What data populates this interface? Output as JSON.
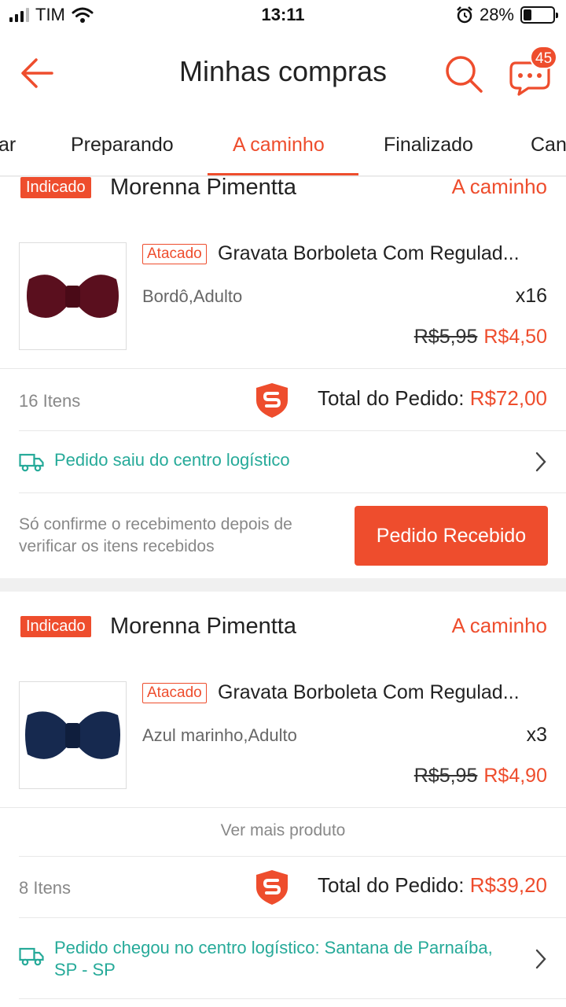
{
  "status_bar": {
    "carrier": "TIM",
    "time": "13:11",
    "battery": "28%",
    "battery_level": 0.28,
    "icons": [
      "signal-icon",
      "wifi-icon",
      "alarm-icon",
      "battery-icon"
    ]
  },
  "header": {
    "title": "Minhas compras",
    "chat_badge": "45",
    "icons": [
      "back-arrow-icon",
      "search-icon",
      "chat-icon"
    ]
  },
  "tabs": [
    {
      "label": "ar"
    },
    {
      "label": "Preparando"
    },
    {
      "label": "A caminho"
    },
    {
      "label": "Finalizado"
    },
    {
      "label": "Can"
    }
  ],
  "active_tab": "A caminho",
  "orders": [
    {
      "badge": "Indicado",
      "seller": "Morenna Pimentta",
      "status": "A caminho",
      "product": {
        "tag": "Atacado",
        "name": "Gravata Borboleta Com Regulad...",
        "variation": "Bordô,Adulto",
        "qty": "x16",
        "price_old": "R$5,95",
        "price_new": "R$4,50",
        "thumb_color": "#5a0f1e"
      },
      "items_count": "16 Itens",
      "total_label": "Total do Pedido:",
      "total_value": "R$72,00",
      "logistics": "Pedido saiu do centro logístico",
      "confirm_note": "Só confirme o recebimento depois de verificar os itens recebidos",
      "action_button": "Pedido Recebido"
    },
    {
      "badge": "Indicado",
      "seller": "Morenna Pimentta",
      "status": "A caminho",
      "product": {
        "tag": "Atacado",
        "name": "Gravata Borboleta Com Regulad...",
        "variation": "Azul marinho,Adulto",
        "qty": "x3",
        "price_old": "R$5,95",
        "price_new": "R$4,90",
        "thumb_color": "#16294f"
      },
      "see_more": "Ver mais produto",
      "items_count": "8 Itens",
      "total_label": "Total do Pedido:",
      "total_value": "R$39,20",
      "logistics": "Pedido chegou no centro logístico: Santana de Parnaíba, SP - SP"
    }
  ],
  "colors": {
    "accent": "#ee4d2d",
    "logistics": "#26aa99",
    "muted": "#888888"
  }
}
